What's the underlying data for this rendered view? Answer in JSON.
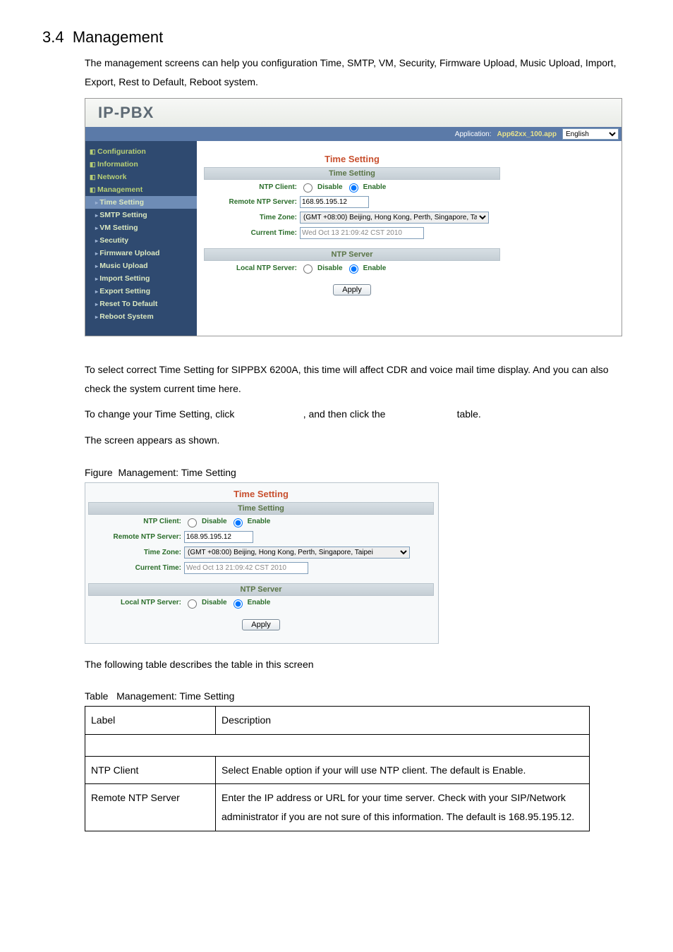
{
  "heading_num": "3.4",
  "heading_title": "Management",
  "intro": "The management screens can help you configuration Time, SMTP, VM, Security, Firmware Upload, Music Upload, Import, Export, Rest to Default, Reboot system.",
  "logo": "IP-PBX",
  "appbar": {
    "label": "Application:",
    "appname": "App62xx_100.app",
    "lang": "English"
  },
  "sidebar": {
    "cat0": "Configuration",
    "cat1": "Information",
    "cat2": "Network",
    "cat3": "Management",
    "items": [
      "Time Setting",
      "SMTP Setting",
      "VM Setting",
      "Secutity",
      "Firmware Upload",
      "Music Upload",
      "Import Setting",
      "Export Setting",
      "Reset To Default",
      "Reboot System"
    ]
  },
  "panel": {
    "title": "Time Setting",
    "sub1": "Time Setting",
    "ntp_client_lbl": "NTP Client:",
    "disable": "Disable",
    "enable": "Enable",
    "remote_lbl": "Remote NTP Server:",
    "remote_val": "168.95.195.12",
    "tz_lbl": "Time Zone:",
    "tz_val": "(GMT +08:00) Beijing, Hong Kong, Perth, Singapore, Taipei",
    "current_lbl": "Current Time:",
    "current_val": "Wed Oct 13 21:09:42 CST 2010",
    "sub2": "NTP Server",
    "local_lbl": "Local NTP Server:",
    "apply": "Apply"
  },
  "para2a": "To select correct Time Setting for SIPPBX 6200A, this time will affect CDR and voice mail time display. And you can also check the system current time here.",
  "para2b_pre": "To change your Time Setting, click ",
  "para2b_mid": ", and then click the ",
  "para2b_post": " table.",
  "para2c": "The screen appears as shown.",
  "fig_caption": "Figure  Management: Time Setting",
  "tbl_caption": "Table   Management: Time Setting",
  "following": "The following table describes the table in this screen",
  "thead": {
    "c0": "Label",
    "c1": "Description"
  },
  "rows": [
    {
      "c0": "NTP Client",
      "c1": "Select Enable option if your will use NTP client. The default is Enable."
    },
    {
      "c0": "Remote NTP Server",
      "c1": "Enter the IP address or URL for your time server. Check with your SIP/Network administrator if you are not sure of this information. The default is 168.95.195.12."
    }
  ]
}
